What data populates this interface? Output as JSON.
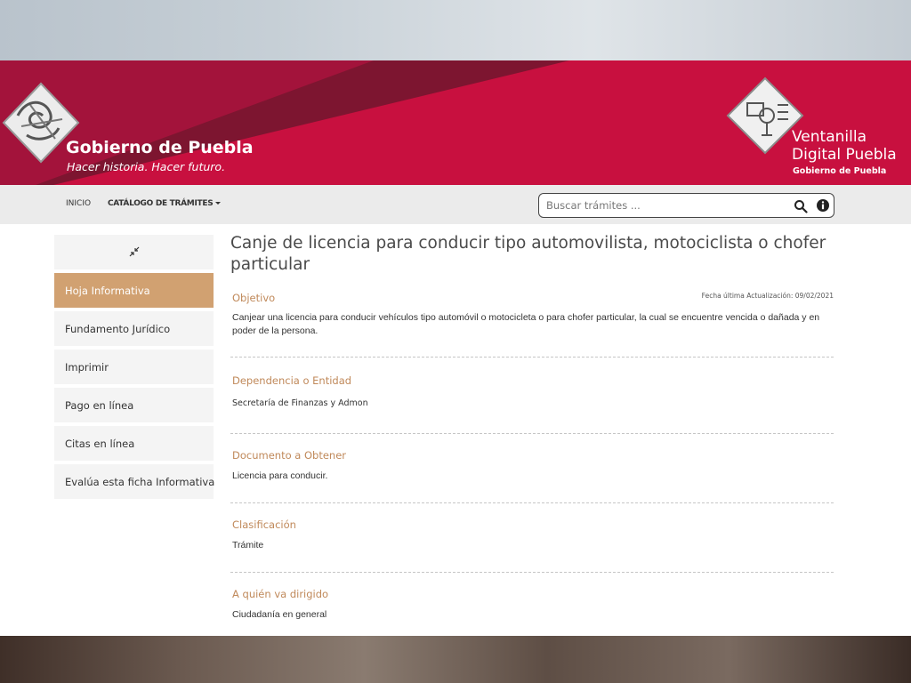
{
  "header": {
    "gov_title": "Gobierno de Puebla",
    "gov_slogan": "Hacer historia. Hacer futuro.",
    "portal_title_line1": "Ventanilla",
    "portal_title_line2": "Digital Puebla",
    "portal_subtitle": "Gobierno de Puebla",
    "colors": {
      "primary": "#c8103f",
      "dark": "#7d1530",
      "accent": "#d1a171"
    }
  },
  "nav": {
    "inicio": "INICIO",
    "catalogo": "CATÁLOGO DE TRÁMITES",
    "search_placeholder": "Buscar trámites ...",
    "search_icon": "search-icon",
    "info_icon": "info-icon"
  },
  "sidebar": {
    "collapse_icon": "collapse-arrows-icon",
    "items": [
      {
        "label": "Hoja Informativa",
        "active": true
      },
      {
        "label": "Fundamento Jurídico",
        "active": false
      },
      {
        "label": "Imprimir",
        "active": false
      },
      {
        "label": "Pago en línea",
        "active": false
      },
      {
        "label": "Citas en línea",
        "active": false
      },
      {
        "label": "Evalúa esta ficha Informativa",
        "active": false
      }
    ]
  },
  "main": {
    "title": "Canje de licencia para conducir tipo automovilista, motociclista o chofer particular",
    "last_updated": "Fecha última Actualización: 09/02/2021",
    "sections": [
      {
        "label": "Objetivo",
        "text": "Canjear una licencia para conducir vehículos tipo automóvil o motocicleta o para chofer particular, la cual se encuentre vencida o dañada y en poder de la persona."
      },
      {
        "label": "Dependencia o Entidad",
        "text": "Secretaría de Finanzas y Admon"
      },
      {
        "label": "Documento a Obtener",
        "text": "Licencia para conducir."
      },
      {
        "label": "Clasificación",
        "text": "Trámite"
      },
      {
        "label": "A quién va dirigido",
        "text": "Ciudadanía en general"
      }
    ]
  }
}
